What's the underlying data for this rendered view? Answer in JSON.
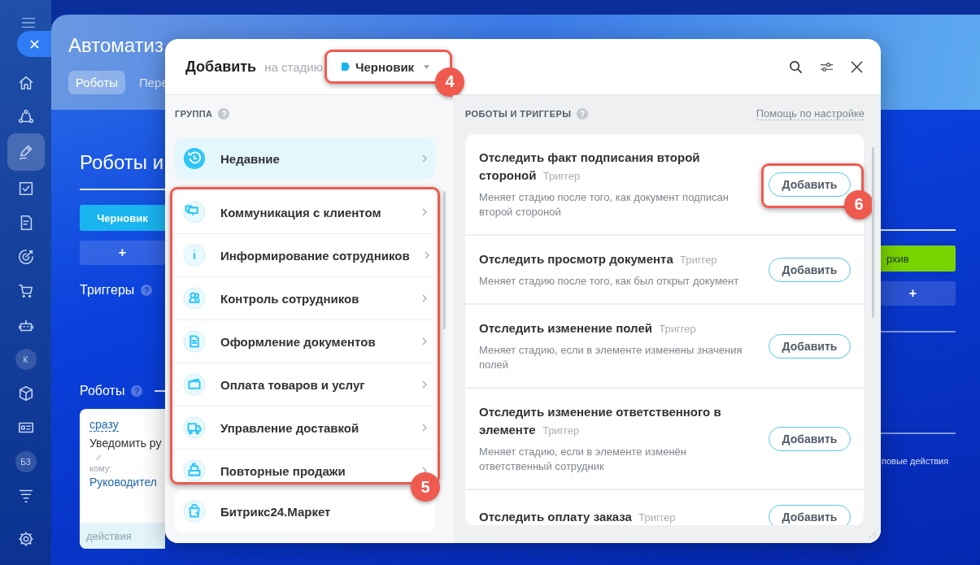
{
  "sidebar": {
    "items": [
      {
        "kind": "icon",
        "selected": false
      },
      {
        "kind": "icon",
        "selected": false
      },
      {
        "kind": "icon",
        "selected": true
      },
      {
        "kind": "icon",
        "selected": false
      },
      {
        "kind": "icon",
        "selected": false
      },
      {
        "kind": "icon",
        "selected": false
      },
      {
        "kind": "icon",
        "selected": false
      },
      {
        "kind": "icon",
        "selected": false
      },
      {
        "kind": "avatar",
        "label": "К",
        "selected": false
      },
      {
        "kind": "icon",
        "selected": false
      },
      {
        "kind": "icon",
        "selected": false
      },
      {
        "kind": "avatar",
        "label": "БЗ",
        "selected": false
      },
      {
        "kind": "icon",
        "selected": false
      },
      {
        "kind": "icon",
        "selected": false
      }
    ]
  },
  "page": {
    "title": "Автоматиз",
    "tabs": [
      {
        "label": "Роботы",
        "selected": true
      },
      {
        "label": "Пере",
        "selected": false
      }
    ],
    "heading": "Роботы и",
    "stages": [
      {
        "label": "Черновик",
        "color": "#1ab5f0",
        "add": "+"
      },
      {
        "label": "рхив",
        "color": "#7ad400",
        "add": "+"
      }
    ],
    "triggers": {
      "title": "Триггеры",
      "help": "?"
    },
    "robots": {
      "title": "Роботы",
      "help": "?"
    },
    "robot_card": {
      "delay": "сразу",
      "title": "Уведомить ру",
      "to_label": "кому:",
      "to_value": "Руководител",
      "footer": "действия"
    },
    "group_actions": "повые действия"
  },
  "dialog": {
    "title": "Добавить",
    "stage_prefix": "на стадию",
    "stage": {
      "label": "Черновик",
      "color": "#1ab5f0",
      "annotation": "4"
    },
    "groups": {
      "title": "ГРУППА",
      "help": "?",
      "annotation": "5",
      "items": [
        {
          "kind": "recent",
          "label": "Недавние",
          "selected": true
        },
        {
          "kind": "category",
          "label": "Коммуникация с клиентом",
          "selected": false
        },
        {
          "kind": "category",
          "label": "Информирование сотрудников",
          "selected": false
        },
        {
          "kind": "category",
          "label": "Контроль сотрудников",
          "selected": false
        },
        {
          "kind": "category",
          "label": "Оформление документов",
          "selected": false
        },
        {
          "kind": "category",
          "label": "Оплата товаров и услуг",
          "selected": false
        },
        {
          "kind": "category",
          "label": "Управление доставкой",
          "selected": false
        },
        {
          "kind": "category",
          "label": "Повторные продажи",
          "selected": false
        },
        {
          "kind": "market",
          "label": "Битрикс24.Маркет",
          "selected": false
        }
      ]
    },
    "catalog": {
      "title": "РОБОТЫ И ТРИГГЕРЫ",
      "help": "?",
      "help_link": "Помощь по настройке",
      "items": [
        {
          "title": "Отследить факт подписания второй стороной",
          "tag": "Триггер",
          "description": "Меняет стадию после того, как документ подписан второй стороной",
          "button": "Добавить",
          "annotation": "6"
        },
        {
          "title": "Отследить просмотр документа",
          "tag": "Триггер",
          "description": "Меняет стадию после того, как был открыт документ",
          "button": "Добавить"
        },
        {
          "title": "Отследить изменение полей",
          "tag": "Триггер",
          "description": "Меняет стадию, если в элементе изменены значения полей",
          "button": "Добавить"
        },
        {
          "title": "Отследить изменение ответственного в элементе",
          "tag": "Триггер",
          "description": "Меняет стадию, если в элементе изменён ответственный сотрудник",
          "button": "Добавить"
        },
        {
          "title": "Отследить оплату заказа",
          "tag": "Триггер",
          "button": "Добавить"
        }
      ]
    }
  }
}
